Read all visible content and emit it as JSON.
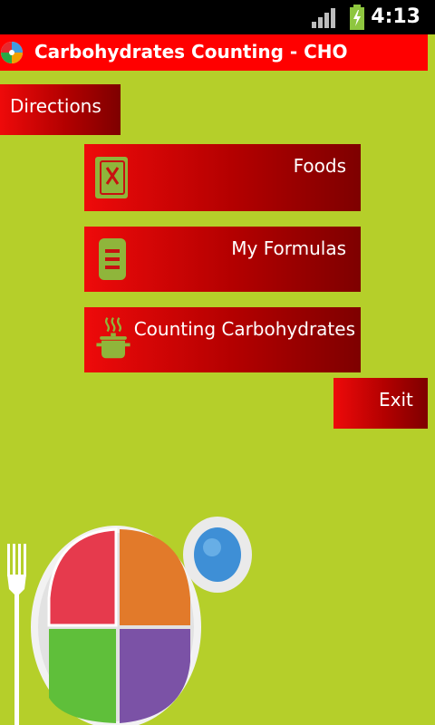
{
  "status_bar": {
    "time": "4:13",
    "signal_icon": "signal-bars-icon",
    "battery_icon": "battery-charging-icon"
  },
  "app_bar": {
    "title": "Carbohydrates Counting - CHO",
    "icon": "app-logo-icon"
  },
  "menu": {
    "directions": "Directions",
    "foods": "Foods",
    "my_formulas": "My Formulas",
    "counting_carbohydrates": "Counting Carbohydrates",
    "exit": "Exit"
  },
  "icons": {
    "foods": "recipe-book-icon",
    "my_formulas": "notes-icon",
    "counting_carbohydrates": "cooking-pot-icon"
  },
  "colors": {
    "background": "#b5cf2a",
    "title_bar": "#ff0000",
    "button_start": "#ee0a0a",
    "button_end": "#7e0000",
    "icon_green": "#8fb53b"
  }
}
